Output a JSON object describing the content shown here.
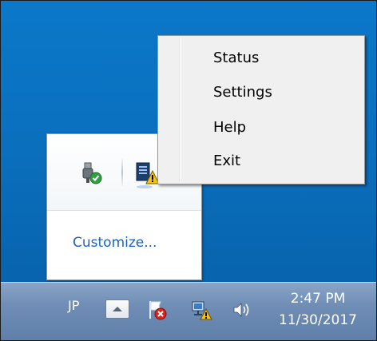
{
  "context_menu": {
    "items": [
      {
        "label": "Status"
      },
      {
        "label": "Settings"
      },
      {
        "label": "Help"
      },
      {
        "label": "Exit"
      }
    ]
  },
  "flyout": {
    "customize_label": "Customize...",
    "icons": [
      "usb-safe-remove-icon",
      "app-warning-icon"
    ]
  },
  "taskbar": {
    "language": "JP",
    "show_hidden_icon": "chevron-up-icon",
    "tray_icons": [
      "action-center-error-icon",
      "network-warning-icon",
      "volume-icon"
    ],
    "time": "2:47 PM",
    "date": "11/30/2017"
  },
  "colors": {
    "desktop": "#0a6fbd",
    "link": "#1a62c4",
    "taskbar": "#6f8db5"
  }
}
